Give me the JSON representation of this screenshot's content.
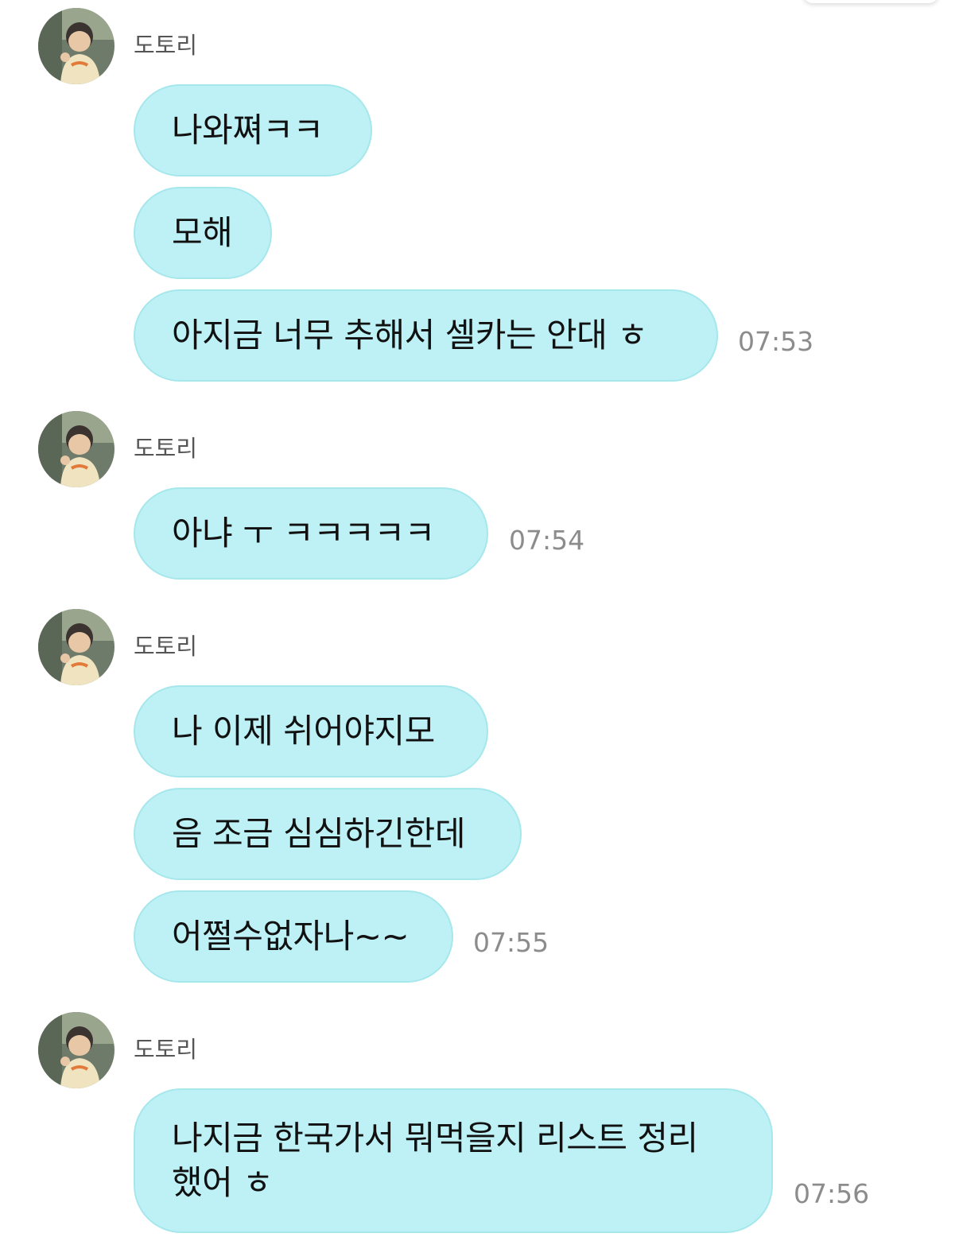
{
  "groups": [
    {
      "sender": "도토리",
      "messages": [
        "나와쪄ㅋㅋ",
        "모해",
        "아지금 너무 추해서 셀카는 안대 ㅎ"
      ],
      "time": "07:53"
    },
    {
      "sender": "도토리",
      "messages": [
        "아냐 ㅜ ㅋㅋㅋㅋㅋ"
      ],
      "time": "07:54"
    },
    {
      "sender": "도토리",
      "messages": [
        "나 이제 쉬어야지모",
        "음 조금 심심하긴한데",
        "어쩔수없자나~~"
      ],
      "time": "07:55"
    },
    {
      "sender": "도토리",
      "messages": [
        "나지금 한국가서 뭐먹을지 리스트 정리\n했어 ㅎ"
      ],
      "time": "07:56"
    }
  ],
  "colors": {
    "bubble": "#bdf1f5",
    "bubble_border": "#a6e7ec",
    "time": "#8c8c8c",
    "sender": "#555555"
  }
}
